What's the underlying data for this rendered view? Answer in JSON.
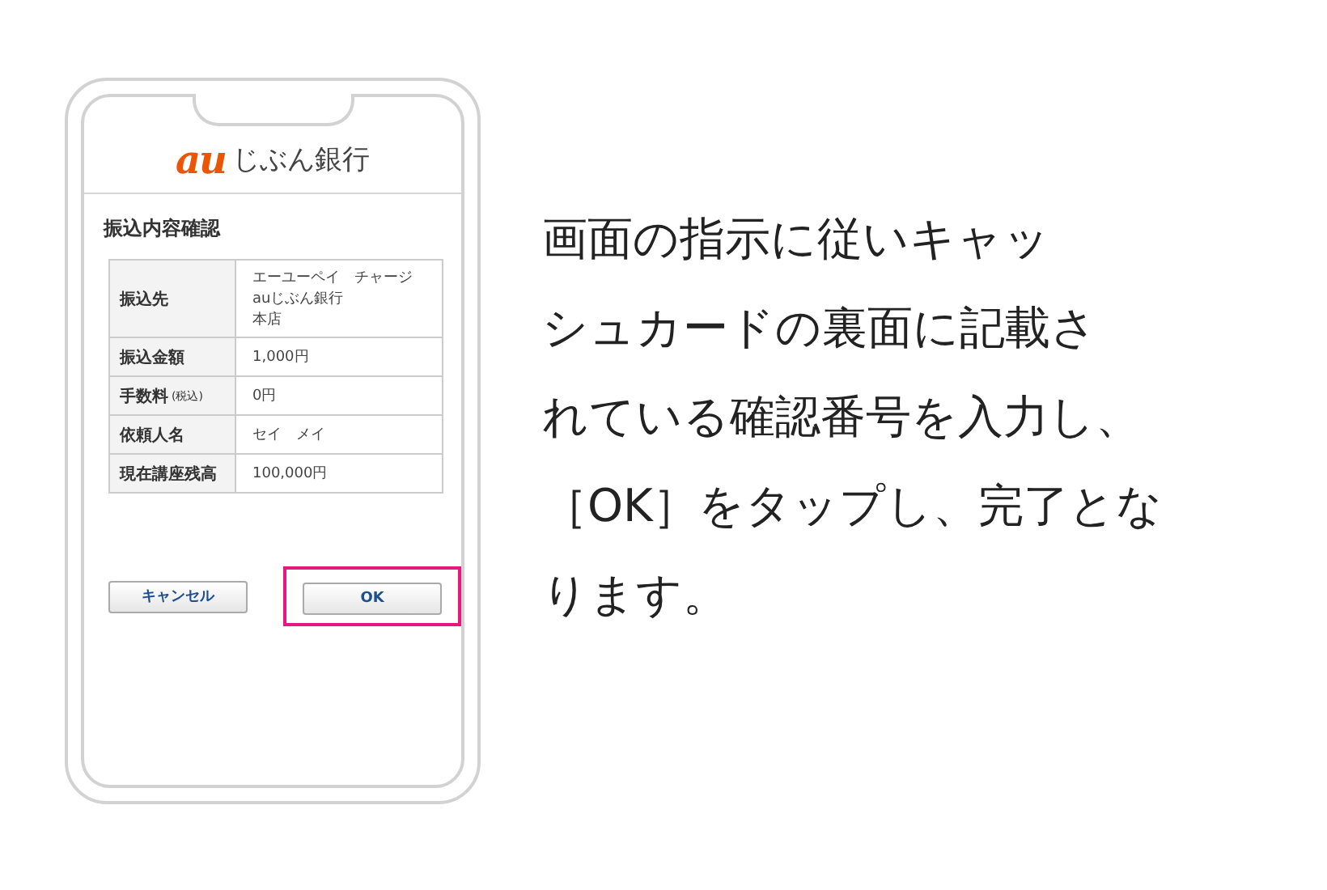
{
  "phone": {
    "logo": {
      "mark": "au",
      "name": "じぶん銀行"
    },
    "title": "振込内容確認",
    "rows": [
      {
        "label": "振込先",
        "value_lines": [
          "エーユーペイ　チャージ",
          "auじぶん銀行",
          "本店"
        ]
      },
      {
        "label": "振込金額",
        "value_lines": [
          "1,000円"
        ]
      },
      {
        "label": "手数料",
        "note": "(税込)",
        "value_lines": [
          "0円"
        ]
      },
      {
        "label": "依頼人名",
        "value_lines": [
          "セイ　メイ"
        ]
      },
      {
        "label": "現在講座残高",
        "value_lines": [
          "100,000円"
        ]
      }
    ],
    "buttons": [
      {
        "label": "キャンセル",
        "highlighted": false
      },
      {
        "label": "OK",
        "highlighted": true
      }
    ]
  },
  "instruction_lines": [
    "画面の指示に従いキャッ",
    "シュカードの裏面に記載さ",
    "れている確認番号を入力し、",
    "［OK］をタップし、完了とな",
    "ります。"
  ]
}
